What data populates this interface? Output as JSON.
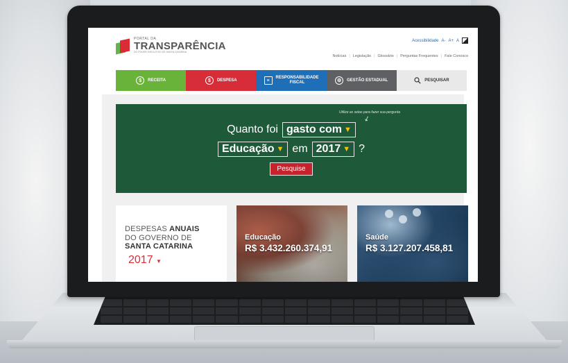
{
  "header": {
    "logo_small": "PORTAL DA",
    "logo_big": "TRANSPARÊNCIA",
    "logo_sub": "DO PODER EXECUTIVO DE SANTA CATARINA",
    "accessibility_label": "Acessibilidade",
    "font_controls": [
      "A-",
      "A+",
      "A"
    ],
    "links": [
      "Notícias",
      "Legislação",
      "Glossário",
      "Perguntas Frequentes",
      "Fale Conosco"
    ]
  },
  "nav": [
    {
      "label": "RECEITA",
      "icon": "dollar-coin-icon",
      "color": "#6ab33a"
    },
    {
      "label": "DESPESA",
      "icon": "dollar-coin-icon",
      "color": "#d62d39"
    },
    {
      "label_line1": "RESPONSABILIDADE",
      "label_line2": "FISCAL",
      "icon": "document-icon",
      "color": "#1f6fb8"
    },
    {
      "label": "GESTÃO ESTADUAL",
      "icon": "gears-icon",
      "color": "#5f6063"
    },
    {
      "label": "PESQUISAR",
      "icon": "search-icon",
      "color": "#e9e9ea"
    }
  ],
  "hero": {
    "line1_prefix": "Quanto foi",
    "select_action": "gasto com",
    "select_area": "Educação",
    "connector": "em",
    "select_year": "2017",
    "question_mark": "?",
    "hint": "Utilize as setas para fazer sua pergunta",
    "search_button": "Pesquise",
    "background": "#1e5a3a"
  },
  "cards": {
    "summary_line1_a": "DESPESAS ",
    "summary_line1_b": "ANUAIS",
    "summary_line2": "DO GOVERNO DE",
    "summary_line3": "SANTA CATARINA",
    "summary_year": "2017",
    "education_label": "Educação",
    "education_value": "R$ 3.432.260.374,91",
    "health_label": "Saúde",
    "health_value": "R$ 3.127.207.458,81"
  }
}
